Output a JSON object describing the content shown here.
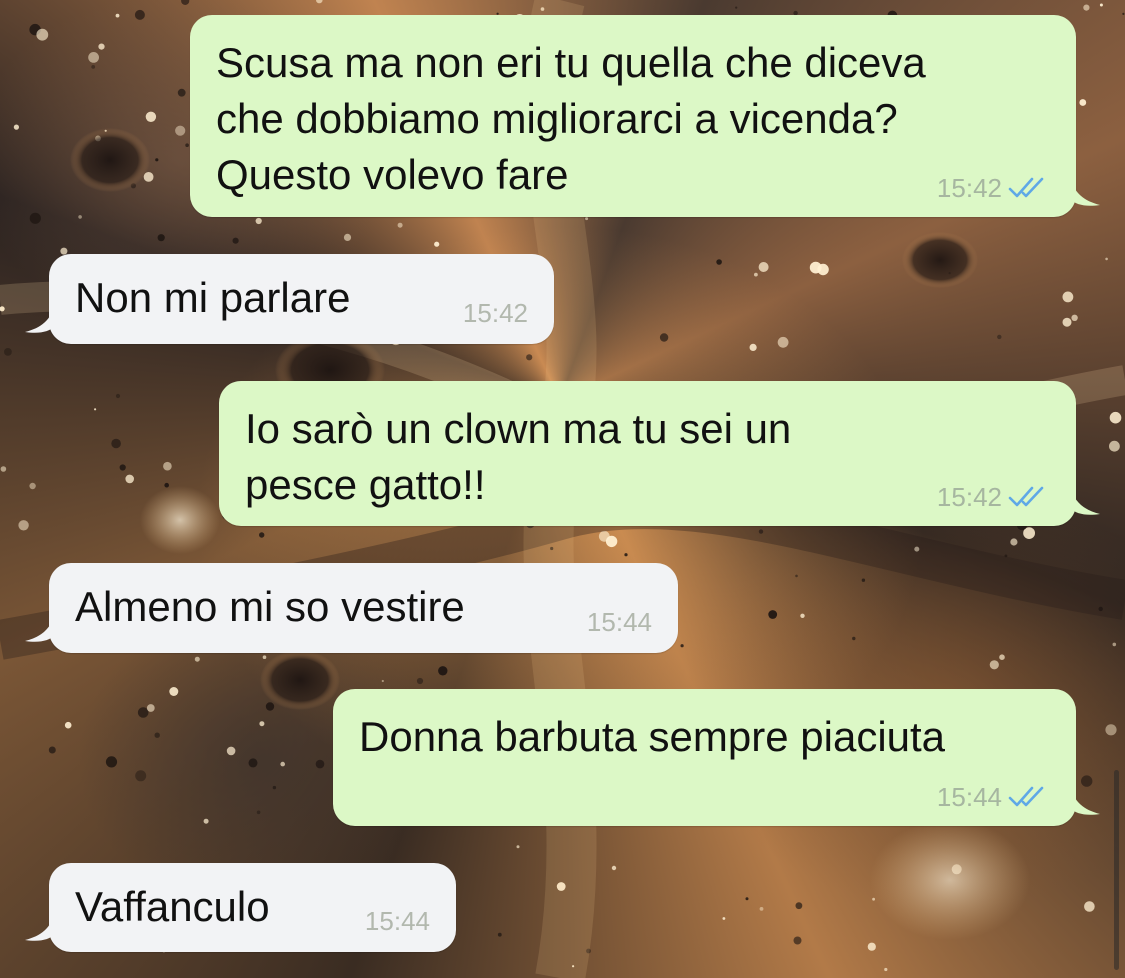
{
  "messages": [
    {
      "direction": "out",
      "text": "Scusa ma non eri tu quella che diceva\nche dobbiamo migliorarci a vicenda?\nQuesto volevo fare",
      "time": "15:42",
      "read": true
    },
    {
      "direction": "in",
      "text": "Non mi parlare",
      "time": "15:42"
    },
    {
      "direction": "out",
      "text": "Io sarò un clown ma tu sei un\npesce gatto!!",
      "time": "15:42",
      "read": true
    },
    {
      "direction": "in",
      "text": "Almeno mi so vestire",
      "time": "15:44"
    },
    {
      "direction": "out",
      "text": "Donna barbuta sempre piaciuta",
      "time": "15:44",
      "read": true
    },
    {
      "direction": "in",
      "text": "Vaffanculo",
      "time": "15:44"
    }
  ],
  "colors": {
    "outgoing_bubble": "#dcf8c6",
    "incoming_bubble": "#f2f3f5",
    "read_ticks": "#5fa8e6",
    "timestamp_out": "#a6b6a0",
    "timestamp_in": "#b2b8ae"
  },
  "icons": {
    "read_receipt": "double-check-icon"
  }
}
